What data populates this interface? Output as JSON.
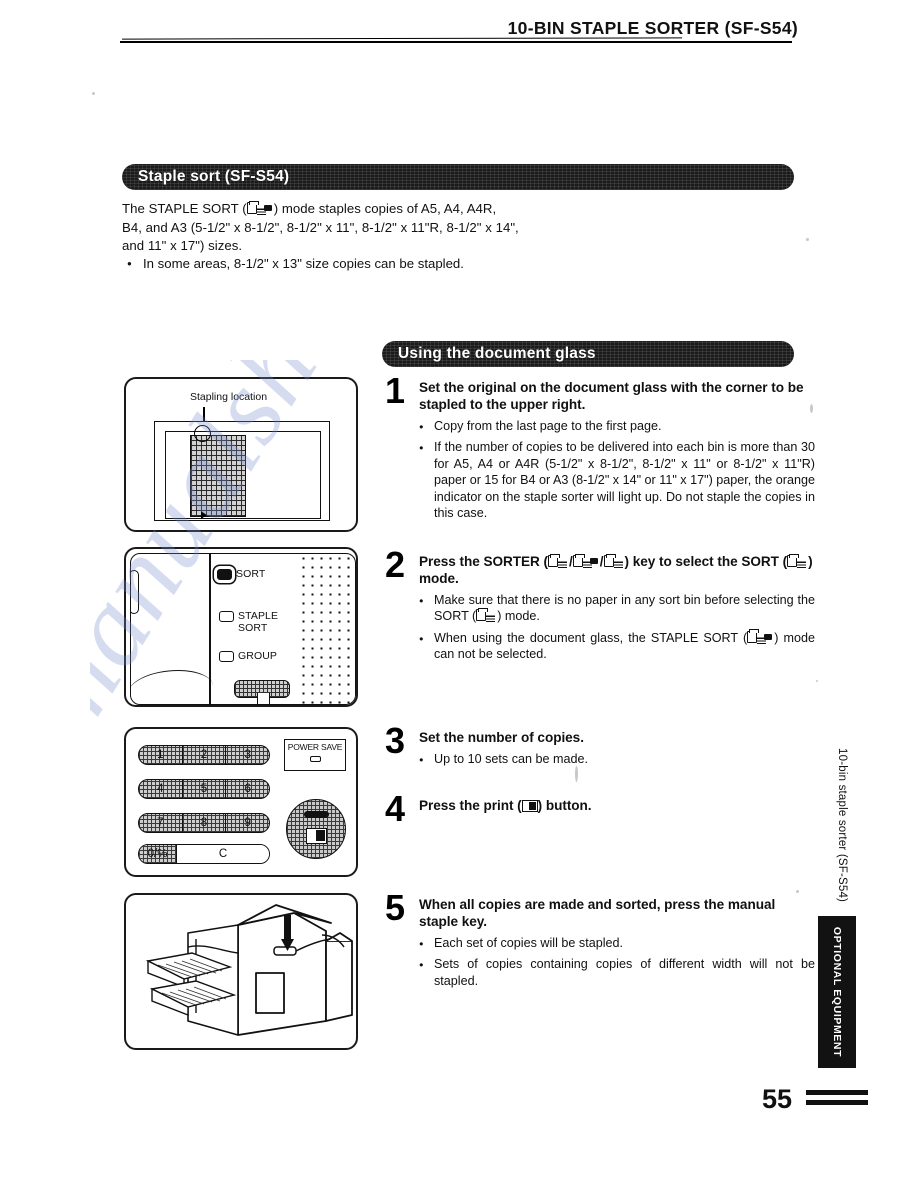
{
  "header": {
    "title": "10-BIN STAPLE SORTER (SF-S54)"
  },
  "sections": {
    "staple_sort_bar": "Staple sort (SF-S54)",
    "doc_glass_bar": "Using the document glass"
  },
  "intro": {
    "line1_a": "The STAPLE SORT (",
    "line1_b": ") mode staples copies of A5, A4, A4R,",
    "line2": "B4, and A3 (5-1/2\" x 8-1/2\", 8-1/2\" x 11\", 8-1/2\" x 11\"R, 8-1/2\" x 14\",",
    "line3": "and 11\" x 17\") sizes.",
    "bullet": "In some areas, 8-1/2\" x 13\" size copies can be stapled."
  },
  "illustrations": {
    "stapling_location_caption": "Stapling location",
    "sorter_panel": {
      "sort_label": "SORT",
      "staple_sort_label": "STAPLE\nSORT",
      "group_label": "GROUP"
    },
    "keypad": {
      "row1": [
        "1",
        "2",
        "3"
      ],
      "row2": [
        "4",
        "5",
        "6"
      ],
      "row3": [
        "7",
        "8",
        "9"
      ],
      "zero": "0/℅",
      "clear": "C",
      "power_save": "POWER SAVE"
    }
  },
  "steps": [
    {
      "number": "1",
      "heading": "Set the original on the document glass with the corner to be stapled to the upper right.",
      "bullets": [
        "Copy from the last page to the first page.",
        "If the number of copies to be delivered into each bin is more than 30 for A5, A4 or A4R (5-1/2\" x 8-1/2\", 8-1/2\" x 11\" or 8-1/2\" x 11\"R) paper or 15 for B4 or A3 (8-1/2\" x 14\" or 11\" x 17\") paper, the orange indicator on the staple sorter will light up. Do not staple the copies in this case."
      ]
    },
    {
      "number": "2",
      "heading_a": "Press the SORTER (",
      "heading_sep1": "/",
      "heading_sep2": "/",
      "heading_b": ") key to select the SORT (",
      "heading_c": ") mode.",
      "bullet1_a": "Make sure that there is no paper in any sort bin before selecting the SORT (",
      "bullet1_b": ") mode.",
      "bullet2_a": "When using the document glass, the STAPLE SORT (",
      "bullet2_b": ") mode can not be selected."
    },
    {
      "number": "3",
      "heading": "Set the number of copies.",
      "bullets": [
        "Up to 10 sets can be made."
      ]
    },
    {
      "number": "4",
      "heading_a": "Press the print (",
      "heading_b": ") button."
    },
    {
      "number": "5",
      "heading": "When all copies are made and sorted, press the manual staple key.",
      "bullets": [
        "Each set of copies will be stapled.",
        "Sets of copies containing copies of different width will not be stapled."
      ]
    }
  ],
  "side": {
    "vertical_label": "10-bin staple sorter (SF-S54)",
    "tab_label": "OPTIONAL EQUIPMENT"
  },
  "footer": {
    "page_number": "55"
  },
  "watermark": {
    "text": "manualshive.com"
  }
}
